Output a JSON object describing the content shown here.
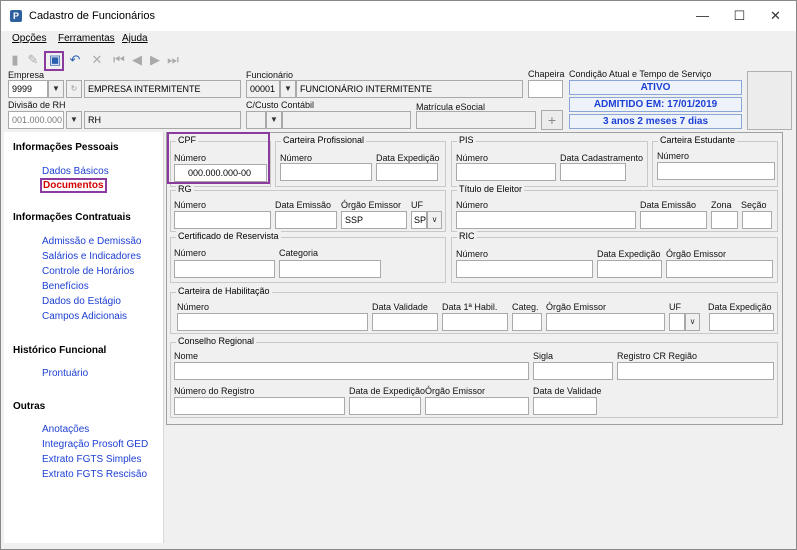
{
  "window": {
    "title": "Cadastro de Funcionários",
    "minimize": "—",
    "maximize": "☐",
    "close": "✕"
  },
  "menu": [
    "Opções",
    "Ferramentas",
    "Ajuda"
  ],
  "header": {
    "empresa_label": "Empresa",
    "empresa_code": "9999",
    "empresa_name": "EMPRESA INTERMITENTE",
    "funcionario_label": "Funcionário",
    "funcionario_code": "00001",
    "funcionario_name": "FUNCIONÁRIO INTERMITENTE",
    "chapeira_label": "Chapeira",
    "condicao_label": "Condição Atual e Tempo de Serviço",
    "status_ativo": "ATIVO",
    "admitido": "ADMITIDO EM: 17/01/2019",
    "tempo": "3 anos 2 meses 7 dias",
    "divisao_label": "Divisão de RH",
    "divisao_code": "001.000.000",
    "divisao_name": "RH",
    "ccusto_label": "C/Custo Contábil",
    "matricula_label": "Matrícula eSocial"
  },
  "sidebar": {
    "sections": [
      {
        "title": "Informações Pessoais",
        "items": [
          "Dados Básicos",
          "Documentos"
        ]
      },
      {
        "title": "Informações Contratuais",
        "items": [
          "Admissão e Demissão",
          "Salários e Indicadores",
          "Controle de Horários",
          "Benefícios",
          "Dados do Estágio",
          "Campos Adicionais"
        ]
      },
      {
        "title": "Histórico Funcional",
        "items": [
          "Prontuário"
        ]
      },
      {
        "title": "Outras",
        "items": [
          "Anotações",
          "Integração Prosoft GED",
          "Extrato FGTS Simples",
          "Extrato FGTS Rescisão"
        ]
      }
    ],
    "active": "Documentos"
  },
  "docs": {
    "cpf": {
      "title": "CPF",
      "numero_label": "Número",
      "numero": "000.000.000-00"
    },
    "ctps": {
      "title": "Carteira Profissional",
      "numero_label": "Número",
      "data_label": "Data Expedição"
    },
    "pis": {
      "title": "PIS",
      "numero_label": "Número",
      "data_label": "Data Cadastramento"
    },
    "estudante": {
      "title": "Carteira Estudante",
      "numero_label": "Número"
    },
    "rg": {
      "title": "RG",
      "numero_label": "Número",
      "data_label": "Data Emissão",
      "orgao_label": "Órgão Emissor",
      "orgao": "SSP",
      "uf_label": "UF",
      "uf": "SP"
    },
    "titulo": {
      "title": "Título de Eleitor",
      "numero_label": "Número",
      "data_label": "Data Emissão",
      "zona_label": "Zona",
      "secao_label": "Seção"
    },
    "reservista": {
      "title": "Certificado de Reservista",
      "numero_label": "Número",
      "categoria_label": "Categoria"
    },
    "ric": {
      "title": "RIC",
      "numero_label": "Número",
      "data_label": "Data Expedição",
      "orgao_label": "Órgão Emissor"
    },
    "cnh": {
      "title": "Carteira de Habilitação",
      "numero_label": "Número",
      "validade_label": "Data Validade",
      "primeira_label": "Data 1ª Habil.",
      "categ_label": "Categ.",
      "orgao_label": "Órgão Emissor",
      "uf_label": "UF",
      "data_label": "Data Expedição"
    },
    "conselho": {
      "title": "Conselho Regional",
      "nome_label": "Nome",
      "sigla_label": "Sigla",
      "regiao_label": "Registro CR Região",
      "registro_label": "Número do Registro",
      "data_label": "Data de Expedição",
      "orgao_label": "Órgão Emissor",
      "validade_label": "Data de Validade"
    }
  }
}
